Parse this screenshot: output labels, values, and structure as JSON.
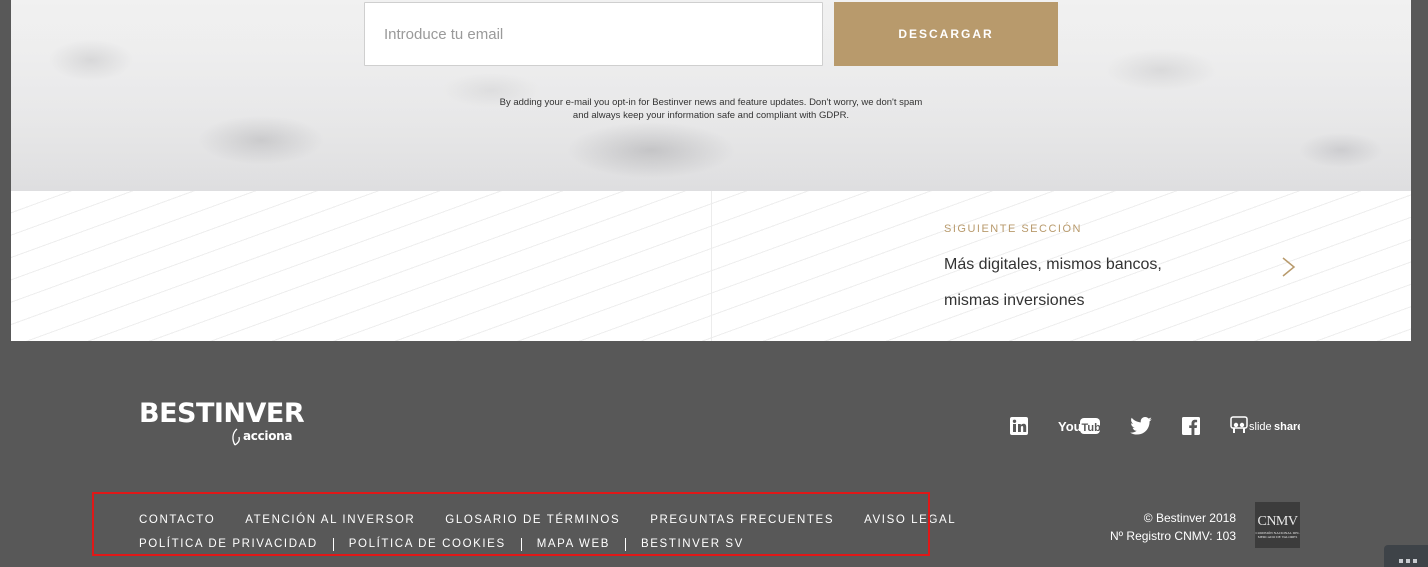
{
  "newsletter": {
    "email_placeholder": "Introduce tu email",
    "download_label": "DESCARGAR",
    "gdpr_line1": "By adding your e-mail you opt-in for Bestinver news and feature updates. Don't worry, we don't spam",
    "gdpr_line2": "and always keep your information safe and compliant with GDPR."
  },
  "next_section": {
    "kicker": "SIGUIENTE SECCIÓN",
    "title": "Más digitales, mismos bancos, mismas inversiones"
  },
  "footer": {
    "logo": {
      "brand": "BESTINVER",
      "sub": "acciona"
    },
    "social": [
      {
        "name": "linkedin-icon",
        "label": "in"
      },
      {
        "name": "youtube-icon",
        "label": "YouTube"
      },
      {
        "name": "twitter-icon",
        "label": "twitter"
      },
      {
        "name": "facebook-icon",
        "label": "f"
      },
      {
        "name": "slideshare-icon",
        "label": "slideshare"
      }
    ],
    "links_row1": [
      "CONTACTO",
      "ATENCIÓN AL INVERSOR",
      "GLOSARIO DE TÉRMINOS",
      "PREGUNTAS FRECUENTES",
      "AVISO LEGAL"
    ],
    "links_row2": [
      "POLÍTICA DE PRIVACIDAD",
      "POLÍTICA DE COOKIES",
      "MAPA WEB",
      "BESTINVER SV"
    ],
    "copyright": "© Bestinver 2018",
    "registry": "Nº Registro CNMV: 103",
    "cnmv": {
      "abbr": "CNMV",
      "full": "COMISIÓN NACIONAL DEL MERCADO DE VALORES"
    }
  },
  "colors": {
    "accent": "#b89a6c",
    "footer_bg": "#585858",
    "highlight": "#e01818"
  }
}
